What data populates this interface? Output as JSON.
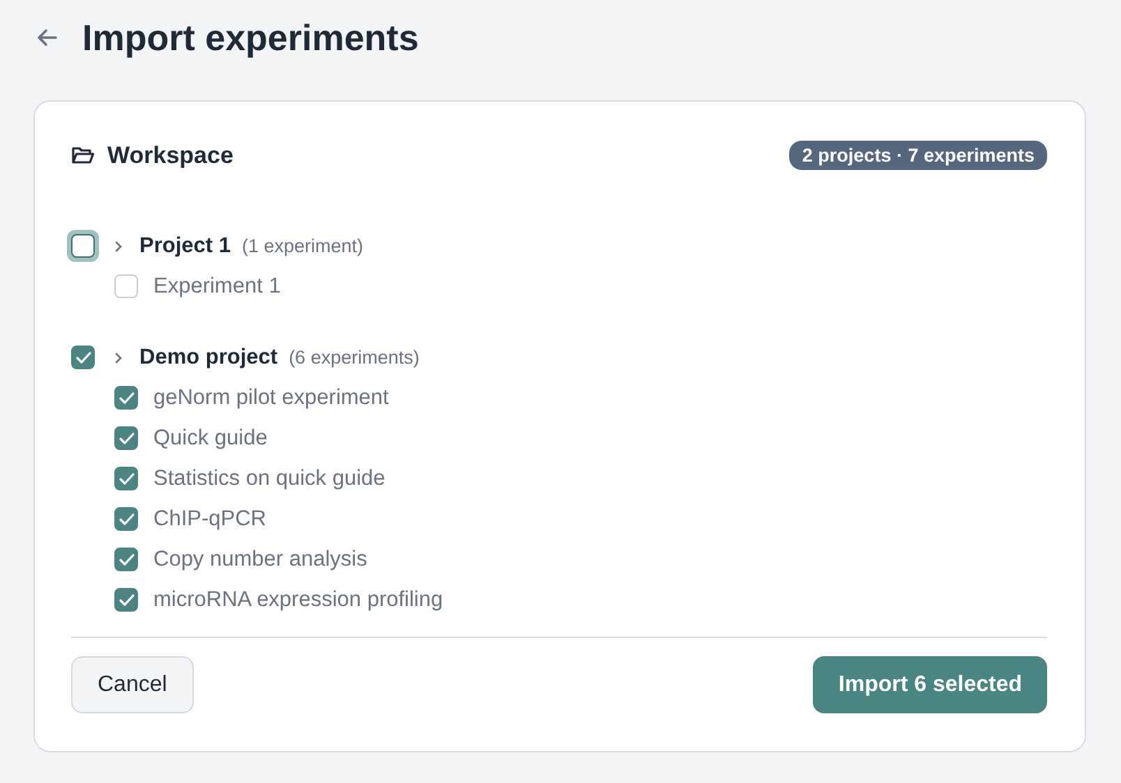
{
  "header": {
    "title": "Import experiments"
  },
  "workspace": {
    "title": "Workspace",
    "badge": "2 projects · 7 experiments"
  },
  "projects": [
    {
      "name": "Project 1",
      "count": "(1 experiment)",
      "checked": false,
      "focused": true,
      "children": [
        {
          "name": "Experiment 1",
          "checked": false
        }
      ]
    },
    {
      "name": "Demo project",
      "count": "(6 experiments)",
      "checked": true,
      "focused": false,
      "children": [
        {
          "name": "geNorm pilot experiment",
          "checked": true
        },
        {
          "name": "Quick guide",
          "checked": true
        },
        {
          "name": "Statistics on quick guide",
          "checked": true
        },
        {
          "name": "ChIP-qPCR",
          "checked": true
        },
        {
          "name": "Copy number analysis",
          "checked": true
        },
        {
          "name": "microRNA expression profiling",
          "checked": true
        }
      ]
    }
  ],
  "buttons": {
    "cancel": "Cancel",
    "import": "Import 6 selected"
  }
}
